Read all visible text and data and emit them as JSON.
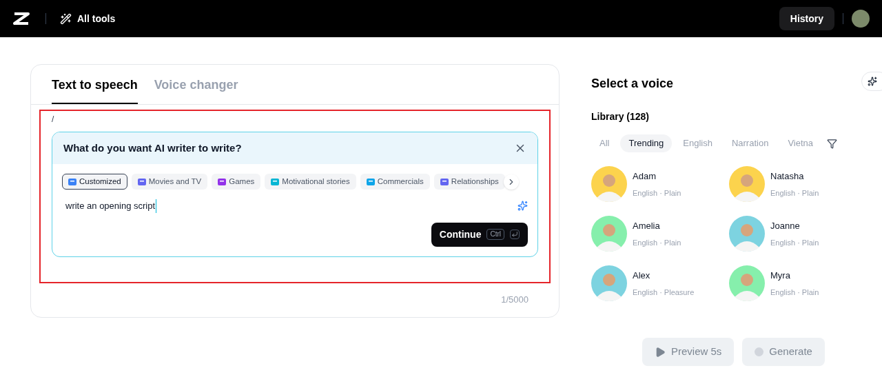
{
  "header": {
    "nav_label": "All tools",
    "history_button": "History"
  },
  "tabs": [
    {
      "label": "Text to speech",
      "selected": true
    },
    {
      "label": "Voice changer",
      "selected": false
    }
  ],
  "editor": {
    "value": "/",
    "counter": "1/5000",
    "highlighted": true
  },
  "ai_writer": {
    "title": "What do you want AI writer to write?",
    "chips": [
      {
        "label": "Customized",
        "selected": true,
        "color": "#3b82f6"
      },
      {
        "label": "Movies and TV",
        "selected": false,
        "color": "#6366f1"
      },
      {
        "label": "Games",
        "selected": false,
        "color": "#9333ea"
      },
      {
        "label": "Motivational stories",
        "selected": false,
        "color": "#06b6d4"
      },
      {
        "label": "Commercials",
        "selected": false,
        "color": "#0ea5e9"
      },
      {
        "label": "Relationships",
        "selected": false,
        "color": "#6366f1"
      }
    ],
    "prompt": "write an opening script",
    "continue_button": "Continue",
    "shortcut": "Ctrl"
  },
  "voice_panel": {
    "title": "Select a voice",
    "library": "Library (128)",
    "filters": [
      {
        "label": "All",
        "selected": false
      },
      {
        "label": "Trending",
        "selected": true
      },
      {
        "label": "English",
        "selected": false
      },
      {
        "label": "Narration",
        "selected": false
      },
      {
        "label": "Vietna",
        "selected": false
      }
    ],
    "voices": [
      {
        "name": "Adam",
        "meta": "English · Plain",
        "color": "#fcd34d"
      },
      {
        "name": "Natasha",
        "meta": "English · Plain",
        "color": "#fcd34d"
      },
      {
        "name": "Amelia",
        "meta": "English · Plain",
        "color": "#86efac"
      },
      {
        "name": "Joanne",
        "meta": "English · Plain",
        "color": "#7dd3e0"
      },
      {
        "name": "Alex",
        "meta": "English · Pleasure",
        "color": "#7dd3e0"
      },
      {
        "name": "Myra",
        "meta": "English · Plain",
        "color": "#86efac"
      }
    ]
  },
  "actions": [
    {
      "label": "Preview 5s",
      "kind": "preview",
      "disabled": true
    },
    {
      "label": "Generate",
      "kind": "generate",
      "disabled": true
    }
  ]
}
